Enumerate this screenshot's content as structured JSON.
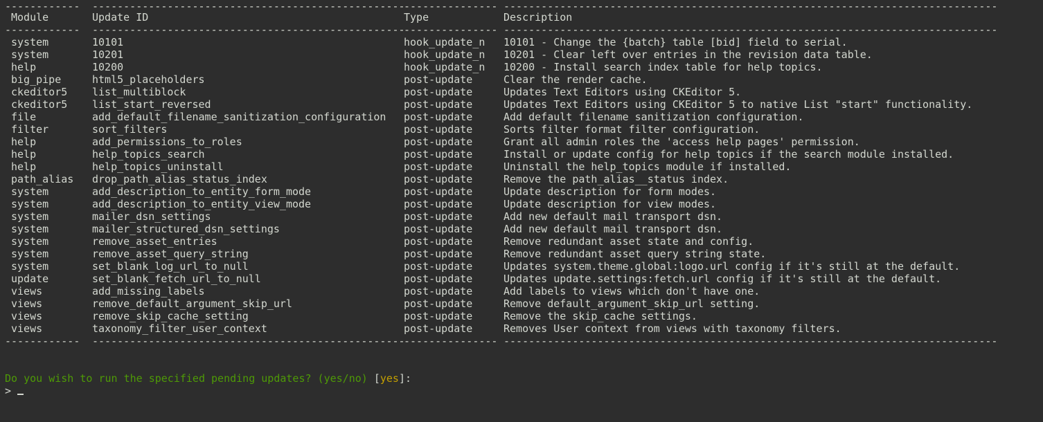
{
  "table": {
    "border_dashes": {
      "module": "------------",
      "updateid": "--------------------------------------------------",
      "type": "---------------",
      "desc": "-------------------------------------------------------------------------------"
    },
    "headers": {
      "module": "Module",
      "updateid": "Update ID",
      "type": "Type",
      "desc": "Description"
    },
    "rows": [
      {
        "module": "system",
        "updateid": "10101",
        "type": "hook_update_n",
        "desc": "10101 - Change the {batch} table [bid] field to serial."
      },
      {
        "module": "system",
        "updateid": "10201",
        "type": "hook_update_n",
        "desc": "10201 - Clear left over entries in the revision data table."
      },
      {
        "module": "help",
        "updateid": "10200",
        "type": "hook_update_n",
        "desc": "10200 - Install search index table for help topics."
      },
      {
        "module": "big_pipe",
        "updateid": "html5_placeholders",
        "type": "post-update",
        "desc": "Clear the render cache."
      },
      {
        "module": "ckeditor5",
        "updateid": "list_multiblock",
        "type": "post-update",
        "desc": "Updates Text Editors using CKEditor 5."
      },
      {
        "module": "ckeditor5",
        "updateid": "list_start_reversed",
        "type": "post-update",
        "desc": "Updates Text Editors using CKEditor 5 to native List \"start\" functionality."
      },
      {
        "module": "file",
        "updateid": "add_default_filename_sanitization_configuration",
        "type": "post-update",
        "desc": "Add default filename sanitization configuration."
      },
      {
        "module": "filter",
        "updateid": "sort_filters",
        "type": "post-update",
        "desc": "Sorts filter format filter configuration."
      },
      {
        "module": "help",
        "updateid": "add_permissions_to_roles",
        "type": "post-update",
        "desc": "Grant all admin roles the 'access help pages' permission."
      },
      {
        "module": "help",
        "updateid": "help_topics_search",
        "type": "post-update",
        "desc": "Install or update config for help topics if the search module installed."
      },
      {
        "module": "help",
        "updateid": "help_topics_uninstall",
        "type": "post-update",
        "desc": "Uninstall the help_topics module if installed."
      },
      {
        "module": "path_alias",
        "updateid": "drop_path_alias_status_index",
        "type": "post-update",
        "desc": "Remove the path_alias__status index."
      },
      {
        "module": "system",
        "updateid": "add_description_to_entity_form_mode",
        "type": "post-update",
        "desc": "Update description for form modes."
      },
      {
        "module": "system",
        "updateid": "add_description_to_entity_view_mode",
        "type": "post-update",
        "desc": "Update description for view modes."
      },
      {
        "module": "system",
        "updateid": "mailer_dsn_settings",
        "type": "post-update",
        "desc": "Add new default mail transport dsn."
      },
      {
        "module": "system",
        "updateid": "mailer_structured_dsn_settings",
        "type": "post-update",
        "desc": "Add new default mail transport dsn."
      },
      {
        "module": "system",
        "updateid": "remove_asset_entries",
        "type": "post-update",
        "desc": "Remove redundant asset state and config."
      },
      {
        "module": "system",
        "updateid": "remove_asset_query_string",
        "type": "post-update",
        "desc": "Remove redundant asset query string state."
      },
      {
        "module": "system",
        "updateid": "set_blank_log_url_to_null",
        "type": "post-update",
        "desc": "Updates system.theme.global:logo.url config if it's still at the default."
      },
      {
        "module": "update",
        "updateid": "set_blank_fetch_url_to_null",
        "type": "post-update",
        "desc": "Updates update.settings:fetch.url config if it's still at the default."
      },
      {
        "module": "views",
        "updateid": "add_missing_labels",
        "type": "post-update",
        "desc": "Add labels to views which don't have one."
      },
      {
        "module": "views",
        "updateid": "remove_default_argument_skip_url",
        "type": "post-update",
        "desc": "Remove default_argument_skip_url setting."
      },
      {
        "module": "views",
        "updateid": "remove_skip_cache_setting",
        "type": "post-update",
        "desc": "Remove the skip_cache settings."
      },
      {
        "module": "views",
        "updateid": "taxonomy_filter_user_context",
        "type": "post-update",
        "desc": "Removes User context from views with taxonomy filters."
      }
    ]
  },
  "prompt": {
    "question": "Do you wish to run the specified pending updates? (yes/no) ",
    "default_open": "[",
    "default_value": "yes",
    "default_close": "]:",
    "input_marker": "> "
  },
  "colors": {
    "background": "#2d2d2d",
    "text": "#d3d7cf",
    "question": "#4e9a06",
    "default_value": "#c4a000"
  }
}
